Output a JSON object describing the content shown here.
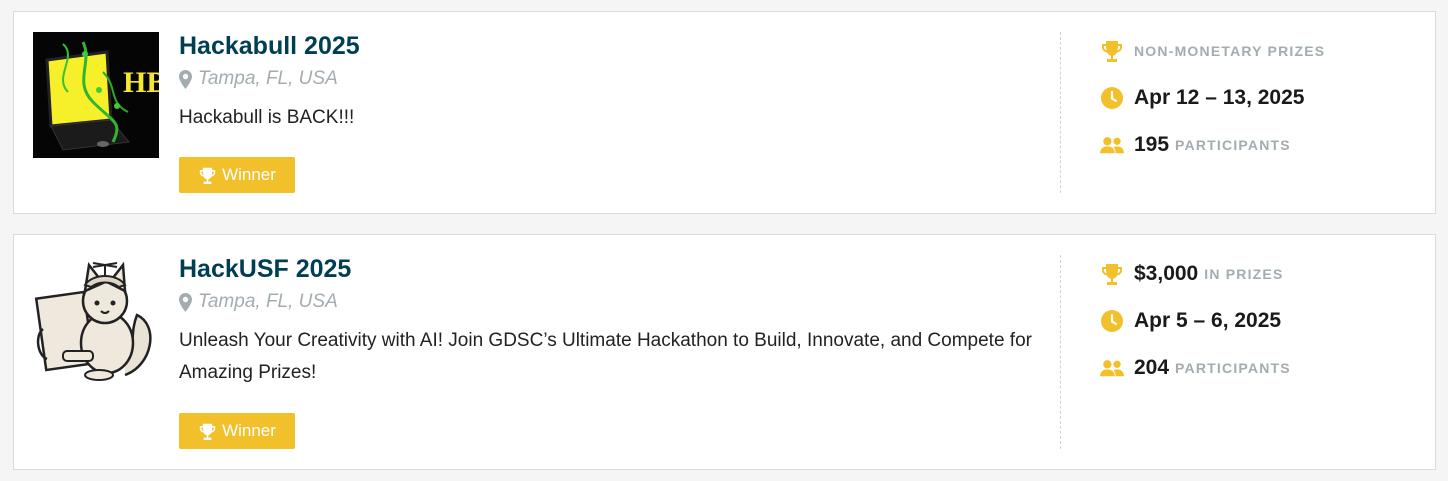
{
  "colors": {
    "accent": "#f2c02a",
    "title": "#003e54",
    "muted": "#a3acb0"
  },
  "hackathons": [
    {
      "title": "Hackabull 2025",
      "location": "Tampa, FL, USA",
      "description": "Hackabull is BACK!!!",
      "badge": "Winner",
      "prizes_amount": "",
      "prizes_label": "NON-MONETARY PRIZES",
      "dates": "Apr 12 – 13, 2025",
      "participants_count": "195",
      "participants_label": "PARTICIPANTS",
      "thumbnail_text": "HB"
    },
    {
      "title": "HackUSF 2025",
      "location": "Tampa, FL, USA",
      "description": "Unleash Your Creativity with AI! Join GDSC’s Ultimate Hackathon to Build, Innovate, and Compete for Amazing Prizes!",
      "badge": "Winner",
      "prizes_amount": "$3,000",
      "prizes_label": "IN PRIZES",
      "dates": "Apr 5 – 6, 2025",
      "participants_count": "204",
      "participants_label": "PARTICIPANTS"
    }
  ]
}
